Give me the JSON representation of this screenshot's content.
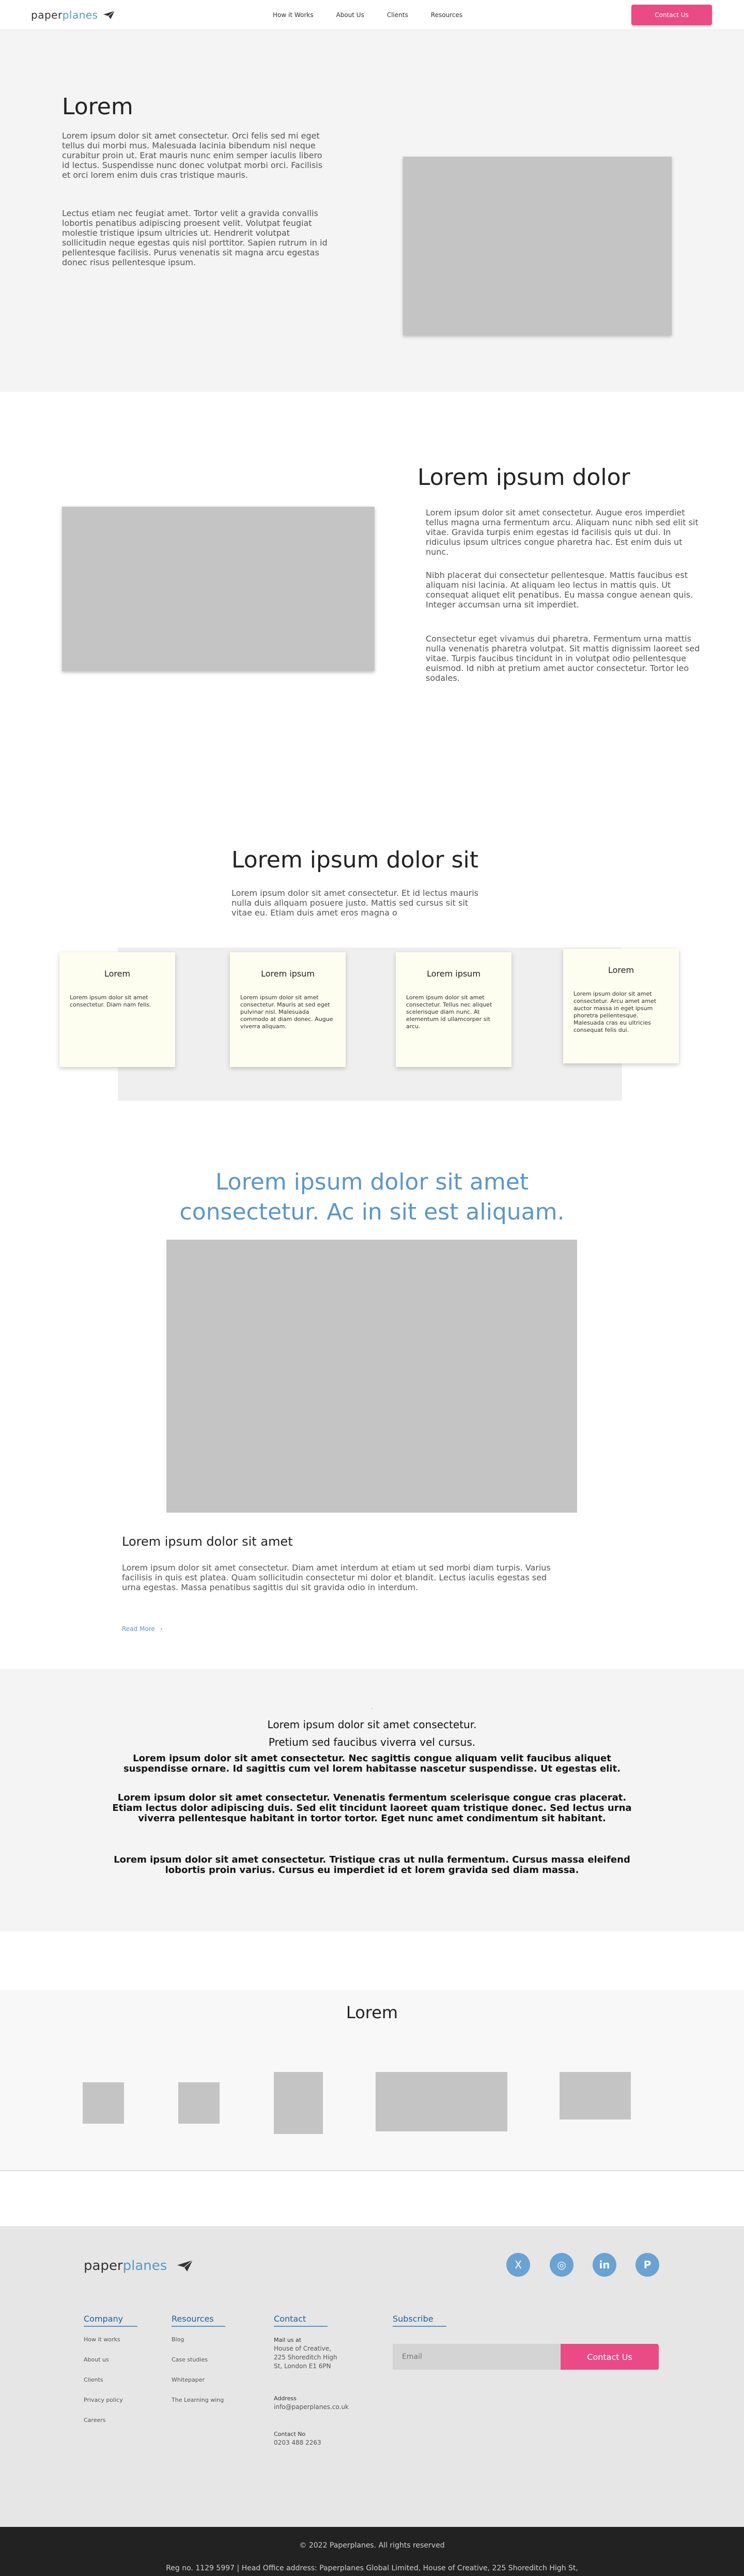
{
  "nav": {
    "logo_a": "paper",
    "logo_b": "planes",
    "links": [
      "How it Works",
      "About Us",
      "Clients",
      "Resources"
    ],
    "cta": "Contact Us"
  },
  "hero": {
    "title": "Lorem",
    "p1": "Lorem ipsum dolor sit amet consectetur. Orci felis sed mi eget tellus dui morbi mus. Malesuada lacinia bibendum nisl neque curabitur proin ut. Erat mauris nunc enim semper iaculis libero id lectus. Suspendisse nunc donec volutpat morbi orci. Facilisis et orci lorem enim duis cras tristique mauris.",
    "p2": "Lectus etiam nec feugiat amet. Tortor velit a gravida convallis lobortis penatibus adipiscing proesent velit. Volutpat feugiat molestie tristique ipsum ultricies ut. Hendrerit volutpat sollicitudin neque egestas quis nisl porttitor. Sapien rutrum in id pellentesque facilisis. Purus venenatis sit magna arcu egestas donec risus pellentesque ipsum."
  },
  "section2": {
    "title": "Lorem ipsum dolor",
    "p1": "Lorem ipsum dolor sit amet consectetur. Augue eros imperdiet tellus magna urna fermentum arcu. Aliquam nunc nibh sed elit sit vitae. Gravida turpis enim egestas id facilisis quis ut dui. In ridiculus ipsum ultrices congue pharetra hac. Est enim duis ut nunc.",
    "p2": "Nibh placerat dui consectetur pellentesque. Mattis faucibus est aliquam nisi lacinia. At aliquam leo lectus in mattis quis. Ut consequat aliquet elit penatibus. Eu massa congue aenean quis. Integer accumsan urna sit imperdiet.",
    "p3": "Consectetur eget vivamus dui pharetra. Fermentum urna mattis nulla venenatis pharetra volutpat. Sit mattis dignissim laoreet sed vitae. Turpis faucibus tincidunt in in volutpat odio pellentesque euismod. Id nibh at pretium amet auctor consectetur. Tortor leo sodales."
  },
  "section3": {
    "title": "Lorem ipsum dolor sit",
    "p": "Lorem ipsum dolor sit amet consectetur. Et id lectus mauris nulla duis aliquam posuere justo. Mattis sed cursus sit sit vitae eu. Etiam duis amet eros magna o",
    "cards": [
      {
        "title": "Lorem",
        "text": "Lorem ipsum dolor sit amet consectetur. Diam nam felis."
      },
      {
        "title": "Lorem ipsum",
        "text": "Lorem ipsum dolor sit amet consectetur. Mauris at sed eget pulvinar nisl. Malesuada commodo at diam donec. Augue viverra aliquam."
      },
      {
        "title": "Lorem ipsum",
        "text": "Lorem ipsum dolor sit amet consectetur. Tellus nec aliquet scelerisque diam nunc. At elementum id ullamcorper sit arcu."
      },
      {
        "title": "Lorem",
        "text": "Lorem ipsum dolor sit amet consectetur. Arcu amet amet auctor massa in eget ipsum phoretra pellentesque. Malesuada cras eu ultricies consequat felis dui."
      }
    ]
  },
  "section4": {
    "quote_l1": "Lorem ipsum dolor sit amet",
    "quote_l2": "consectetur. Ac in sit est aliquam.",
    "title": "Lorem ipsum dolor sit amet",
    "p": "Lorem ipsum dolor sit amet consectetur. Diam amet interdum at etiam ut sed morbi diam turpis. Varius facilisis in quis est platea. Quam sollicitudin consectetur mi dolor et blandit. Lectus iaculis egestas sed urna egestas. Massa penatibus sagittis dui sit gravida odio in interdum.",
    "read_more": "Read More",
    "arrow": "›"
  },
  "section5": {
    "dot": "·",
    "t1": "Lorem ipsum dolor sit amet consectetur.",
    "t2": "Pretium sed faucibus viverra vel cursus.",
    "b1": "Lorem ipsum dolor sit amet consectetur. Nec sagittis congue aliquam velit faucibus aliquet suspendisse ornare. Id sagittis cum vel lorem habitasse nascetur suspendisse. Ut egestas elit.",
    "b2": "Lorem ipsum dolor sit amet consectetur. Venenatis fermentum scelerisque congue cras placerat. Etiam lectus dolor adipiscing duis. Sed elit tincidunt laoreet quam tristique donec. Sed lectus urna viverra pellentesque habitant in tortor tortor. Eget nunc amet condimentum sit habitant.",
    "b3": "Lorem ipsum dolor sit amet consectetur. Tristique cras ut nulla fermentum. Cursus massa eleifend lobortis proin varius. Cursus eu imperdiet id et lorem gravida sed diam massa."
  },
  "section6": {
    "title": "Lorem"
  },
  "footer": {
    "logo_a": "paper",
    "logo_b": "planes",
    "social": [
      "X",
      "◎",
      "in",
      "P"
    ],
    "company_head": "Company",
    "company": [
      "How it works",
      "About us",
      "Clients",
      "Privacy policy",
      "Careers"
    ],
    "resources_head": "Resources",
    "resources": [
      "Blog",
      "Case studies",
      "Whitepaper",
      "The Learning wing"
    ],
    "contact_head": "Contact",
    "visit_label": "Mail us at",
    "visit_lines": [
      "House of Creative,",
      "225 Shoreditch High",
      "St, London E1 6PN"
    ],
    "email_label": "Address",
    "email": "info@paperplanes.co.uk",
    "phone_label": "Contact No",
    "phone": "0203 488 2263",
    "subscribe_head": "Subscribe",
    "email_placeholder": "Email",
    "subscribe_btn": "Contact Us"
  },
  "bottom": {
    "copyright": "© 2022 Paperplanes. All rights reserved",
    "reg": "Reg no. 1129 5997 | Head Office address: Paperplanes Global Limited, House of Creative, 225 Shoreditch High St,"
  },
  "colors": {
    "accent_blue": "#5a97c8",
    "cta_pink": "#ea4b85",
    "placeholder_grey": "#c4c4c4"
  }
}
